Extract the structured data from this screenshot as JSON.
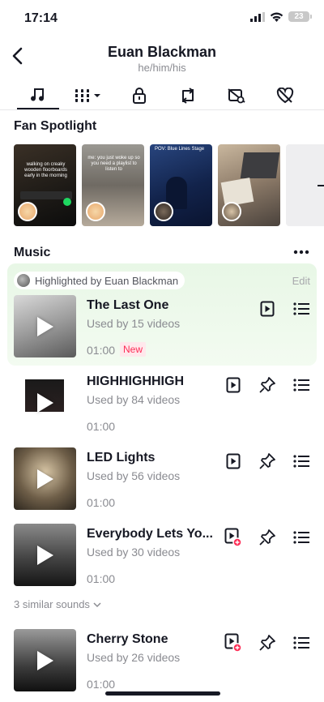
{
  "status": {
    "time": "17:14",
    "battery": "23"
  },
  "profile": {
    "name": "Euan Blackman",
    "pronouns": "he/him/his"
  },
  "tabs": [
    {
      "icon": "music-note-icon"
    },
    {
      "icon": "grid-dropdown-icon"
    },
    {
      "icon": "lock-icon"
    },
    {
      "icon": "repost-icon"
    },
    {
      "icon": "hidden-video-icon"
    },
    {
      "icon": "liked-hidden-icon"
    }
  ],
  "fan_spotlight": {
    "title": "Fan Spotlight",
    "items": [
      {
        "caption": "walking on creaky wooden floorboards early in the morning"
      },
      {
        "caption": "me: you just woke up so you need a playlist to listen to"
      },
      {
        "caption": "POV: Blue Lines Stage"
      },
      {
        "caption": ""
      }
    ]
  },
  "music": {
    "title": "Music",
    "highlight_label": "Highlighted by Euan Blackman",
    "edit_label": "Edit",
    "tracks": [
      {
        "title": "The Last One",
        "used": "Used by 15 videos",
        "duration": "01:00",
        "badge": "New"
      },
      {
        "title": "HIGHHIGHHIGH",
        "used": "Used by 84 videos",
        "duration": "01:00"
      },
      {
        "title": "LED Lights",
        "used": "Used by 56 videos",
        "duration": "01:00"
      },
      {
        "title": "Everybody Lets Yo...",
        "used": "Used by 30 videos",
        "duration": "01:00"
      },
      {
        "title": "Cherry Stone",
        "used": "Used by 26 videos",
        "duration": "01:00"
      }
    ],
    "similar_label": "3 similar sounds"
  },
  "colors": {
    "accent": "#fe2c55",
    "highlight": "#e8f7e6"
  }
}
